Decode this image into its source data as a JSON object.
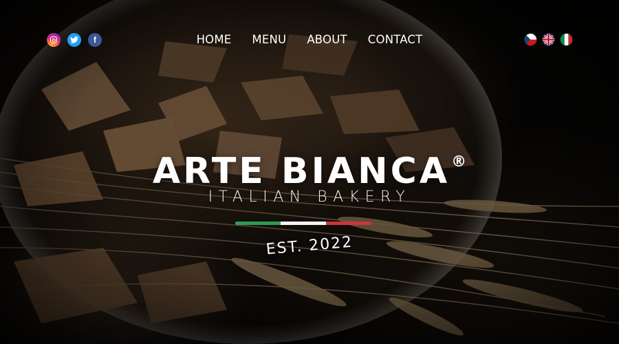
{
  "social": [
    {
      "name": "instagram-icon",
      "glyph": ""
    },
    {
      "name": "twitter-icon",
      "glyph": "t"
    },
    {
      "name": "facebook-icon",
      "glyph": "f"
    }
  ],
  "nav": {
    "items": [
      {
        "label": "HOME"
      },
      {
        "label": "MENU"
      },
      {
        "label": "ABOUT"
      },
      {
        "label": "CONTACT"
      }
    ]
  },
  "languages": [
    {
      "name": "czech-flag-icon"
    },
    {
      "name": "uk-flag-icon"
    },
    {
      "name": "italy-flag-icon"
    }
  ],
  "hero": {
    "brand": "ARTE BIANCA",
    "registered": "®",
    "tagline": "ITALIAN BAKERY",
    "established": "EST. 2022"
  },
  "colors": {
    "italy_green": "#2e9b53",
    "italy_white": "#f3f3f3",
    "italy_red": "#c8373f"
  }
}
